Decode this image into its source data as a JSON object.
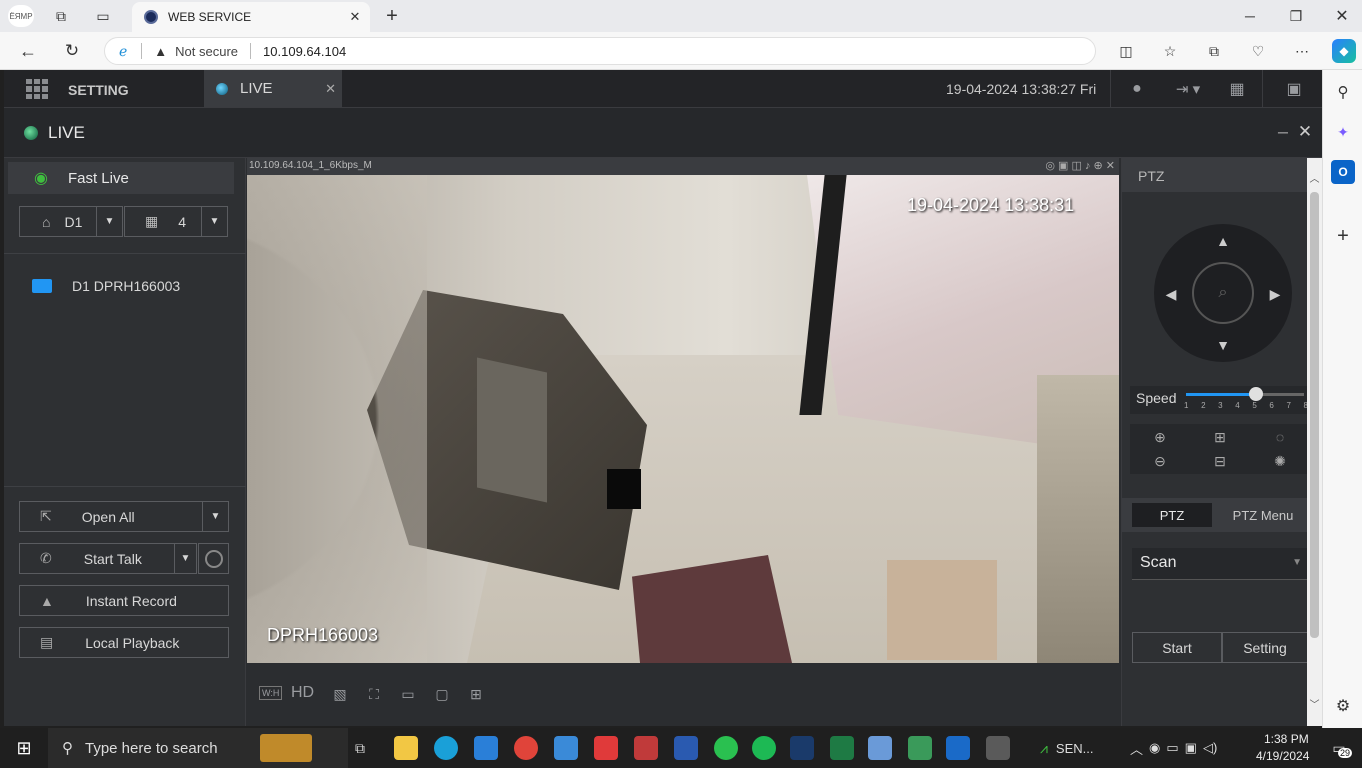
{
  "browser": {
    "tab_title": "WEB SERVICE",
    "security_label": "Not secure",
    "url": "10.109.64.104"
  },
  "app": {
    "setting_label": "SETTING",
    "live_tab_label": "LIVE",
    "datetime": "19-04-2024 13:38:27 Fri",
    "live_header": "LIVE",
    "fast_live_label": "Fast Live",
    "device_select": "D1",
    "layout_count": "4",
    "device_item": "D1 DPRH166003",
    "open_all": "Open All",
    "start_talk": "Start Talk",
    "instant_record": "Instant Record",
    "local_playback": "Local Playback"
  },
  "video": {
    "stream_label": "10.109.64.104_1_6Kbps_M",
    "osd_time": "19-04-2024 13:38:31",
    "osd_name": "DPRH166003",
    "toolbar_wh": "W:H",
    "toolbar_hd": "HD"
  },
  "ptz": {
    "title": "PTZ",
    "speed_label": "Speed",
    "speed_ticks": [
      "1",
      "2",
      "3",
      "4",
      "5",
      "6",
      "7",
      "8"
    ],
    "speed_value": 5,
    "tab_ptz": "PTZ",
    "tab_menu": "PTZ Menu",
    "mode": "Scan",
    "start": "Start",
    "setting": "Setting"
  },
  "taskbar": {
    "search_placeholder": "Type here to search",
    "sensex_label": "SEN...",
    "time": "1:38 PM",
    "date": "4/19/2024",
    "notif_count": "29"
  },
  "colors": {
    "app_bg": "#2b2d30",
    "accent_green": "#3fbf3f",
    "accent_blue": "#2196f3"
  }
}
